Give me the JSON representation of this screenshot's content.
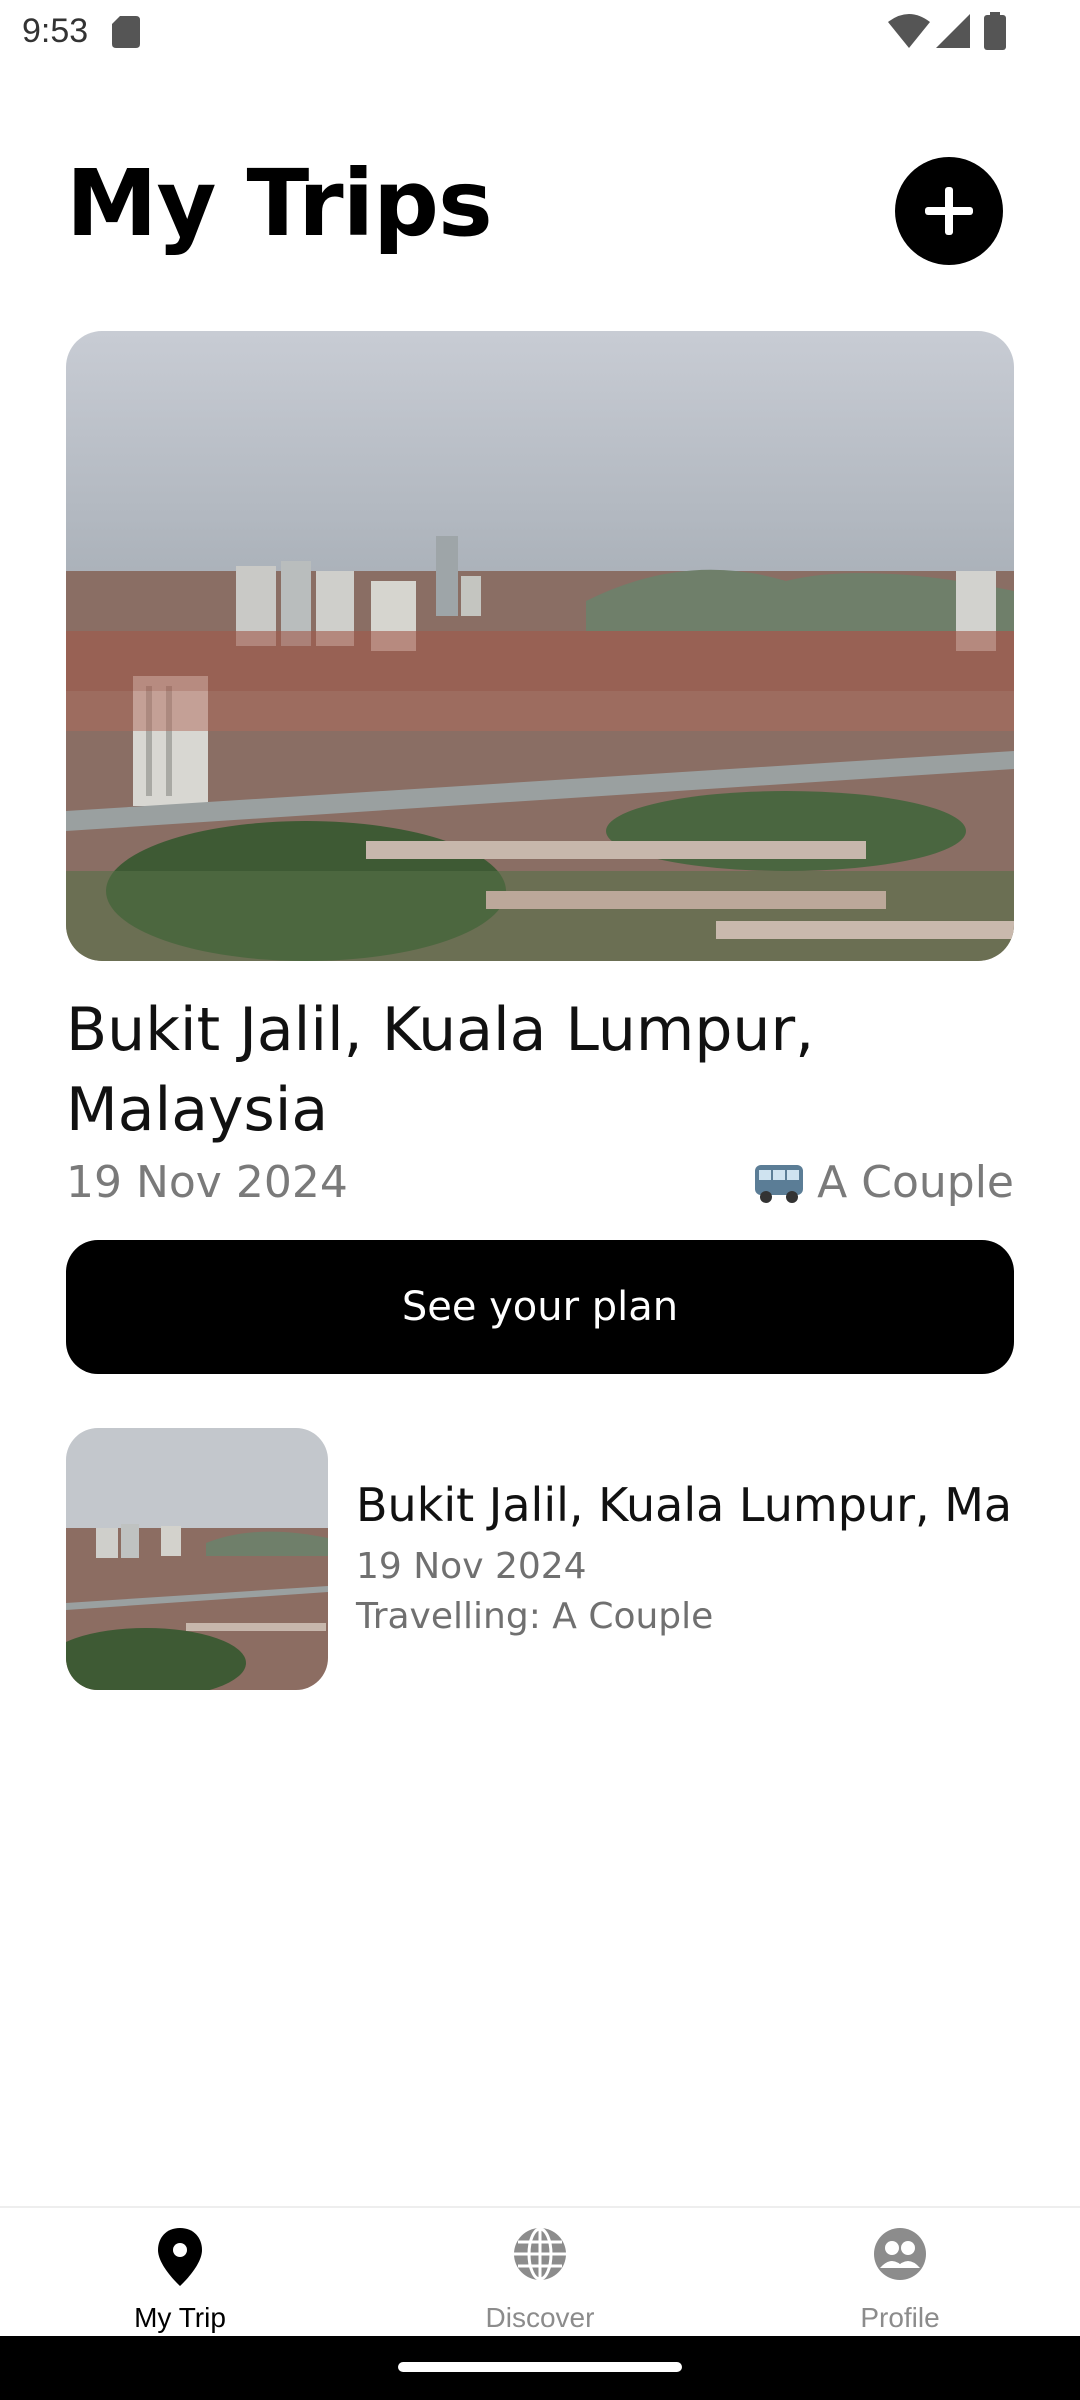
{
  "status_bar": {
    "time": "9:53"
  },
  "header": {
    "title": "My Trips"
  },
  "featured_trip": {
    "location": "Bukit Jalil, Kuala Lumpur, Malaysia",
    "date": "19 Nov 2024",
    "travelers": "A Couple",
    "cta_label": "See your plan"
  },
  "trips_list": [
    {
      "location": "Bukit Jalil, Kuala Lumpur, Malaysia",
      "date": "19 Nov 2024",
      "travelling": "Travelling: A Couple"
    }
  ],
  "bottom_nav": {
    "items": [
      {
        "label": "My Trip",
        "icon": "map-pin-icon",
        "active": true
      },
      {
        "label": "Discover",
        "icon": "globe-icon",
        "active": false
      },
      {
        "label": "Profile",
        "icon": "user-group-icon",
        "active": false
      }
    ]
  },
  "colors": {
    "primary": "#000000",
    "muted_text": "#7a7a7a",
    "inactive_nav": "#8c8c8c"
  }
}
